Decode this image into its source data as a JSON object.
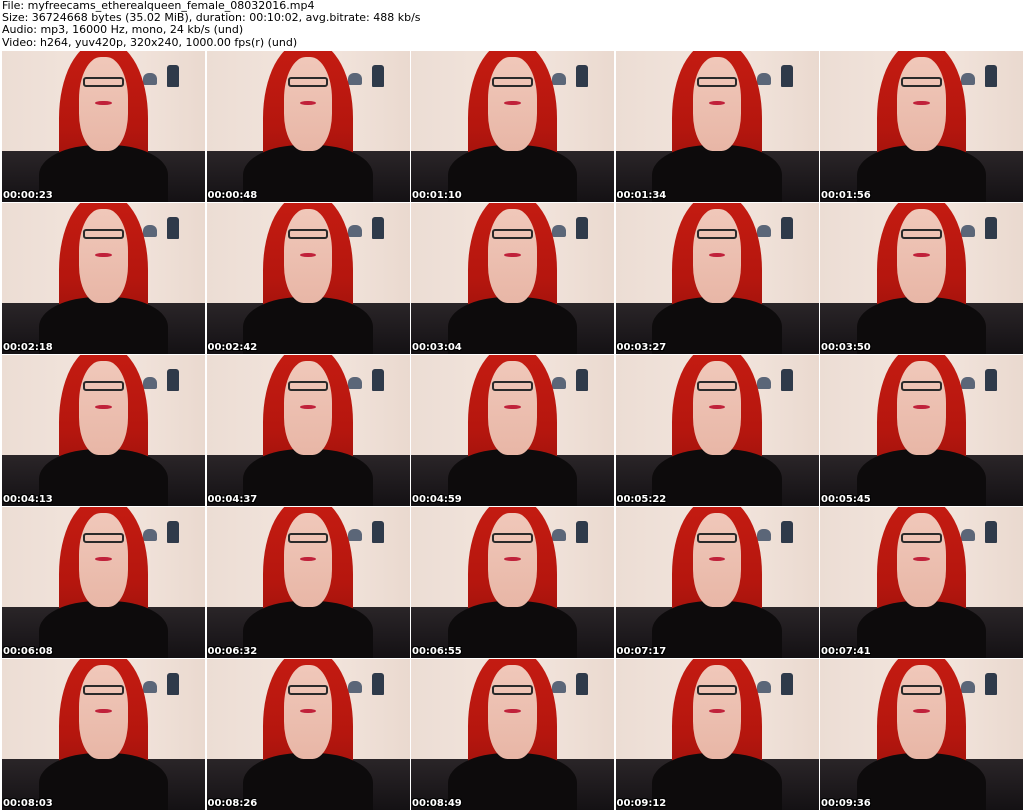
{
  "header": {
    "line1": "File: myfreecams_etherealqueen_female_08032016.mp4",
    "line2": "Size: 36724668 bytes (35.02 MiB), duration: 00:10:02, avg.bitrate: 488 kb/s",
    "line3": "Audio: mp3, 16000 Hz, mono, 24 kb/s (und)",
    "line4": "Video: h264, yuv420p, 320x240, 1000.00 fps(r) (und)"
  },
  "thumbnails": [
    {
      "timestamp": "00:00:23"
    },
    {
      "timestamp": "00:00:48"
    },
    {
      "timestamp": "00:01:10"
    },
    {
      "timestamp": "00:01:34"
    },
    {
      "timestamp": "00:01:56"
    },
    {
      "timestamp": "00:02:18"
    },
    {
      "timestamp": "00:02:42"
    },
    {
      "timestamp": "00:03:04"
    },
    {
      "timestamp": "00:03:27"
    },
    {
      "timestamp": "00:03:50"
    },
    {
      "timestamp": "00:04:13"
    },
    {
      "timestamp": "00:04:37"
    },
    {
      "timestamp": "00:04:59"
    },
    {
      "timestamp": "00:05:22"
    },
    {
      "timestamp": "00:05:45"
    },
    {
      "timestamp": "00:06:08"
    },
    {
      "timestamp": "00:06:32"
    },
    {
      "timestamp": "00:06:55"
    },
    {
      "timestamp": "00:07:17"
    },
    {
      "timestamp": "00:07:41"
    },
    {
      "timestamp": "00:08:03"
    },
    {
      "timestamp": "00:08:26"
    },
    {
      "timestamp": "00:08:49"
    },
    {
      "timestamp": "00:09:12"
    },
    {
      "timestamp": "00:09:36"
    }
  ],
  "colors": {
    "header_text": "#000000",
    "timestamp_text": "#ffffff",
    "hair": "#c51c12",
    "wall": "#f3e6de",
    "top": "#0d0b0c"
  }
}
